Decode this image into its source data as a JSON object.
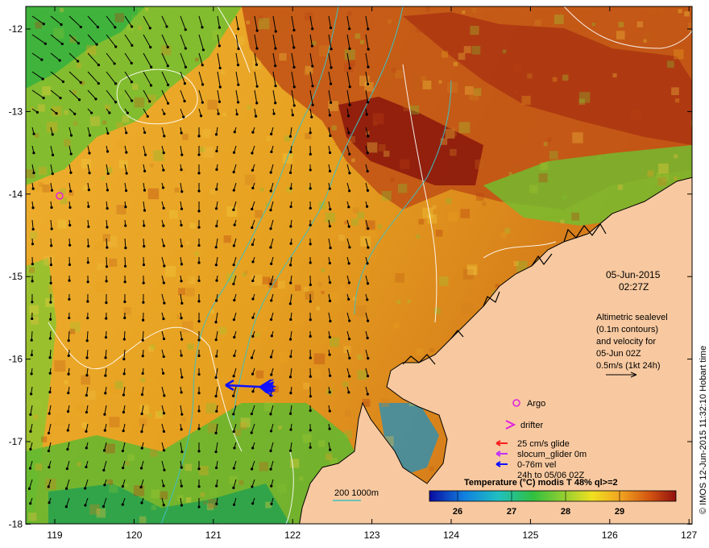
{
  "map": {
    "date_line": "05-Jun-2015",
    "time_line": "02:27Z",
    "altimetry_lines": [
      "Altimetric sealevel",
      "(0.1m contours)",
      "and velocity for",
      "05-Jun 02Z",
      "0.5m/s (1kt 24h)"
    ],
    "credit": "© IMOS 12-Jun-2015 11:32:10 Hobart time",
    "colorbar_title": "Temperature (°C) modis T 48% ql>=2",
    "colorbar_ticks": [
      "26",
      "27",
      "28",
      "29"
    ],
    "x_ticks": [
      "119",
      "120",
      "121",
      "122",
      "123",
      "124",
      "125",
      "126",
      "127"
    ],
    "y_ticks": [
      "-12",
      "-13",
      "-14",
      "-15",
      "-16",
      "-17",
      "-18"
    ],
    "bathymetry_label": "200  1000m",
    "legend": {
      "argo": "Argo",
      "drifter": "drifter",
      "glide_25": "25 cm/s glide",
      "slocum": "slocum_glider 0m",
      "vel": "0-76m vel",
      "vel_time": "24h to 05/06 02Z"
    },
    "colors": {
      "land": "#f8c9a0",
      "argo": "#e020e0",
      "glide": "#ff2020",
      "slocum": "#c030ff",
      "vel": "#1010ff",
      "bathymetry": "#3fbfbf"
    }
  }
}
